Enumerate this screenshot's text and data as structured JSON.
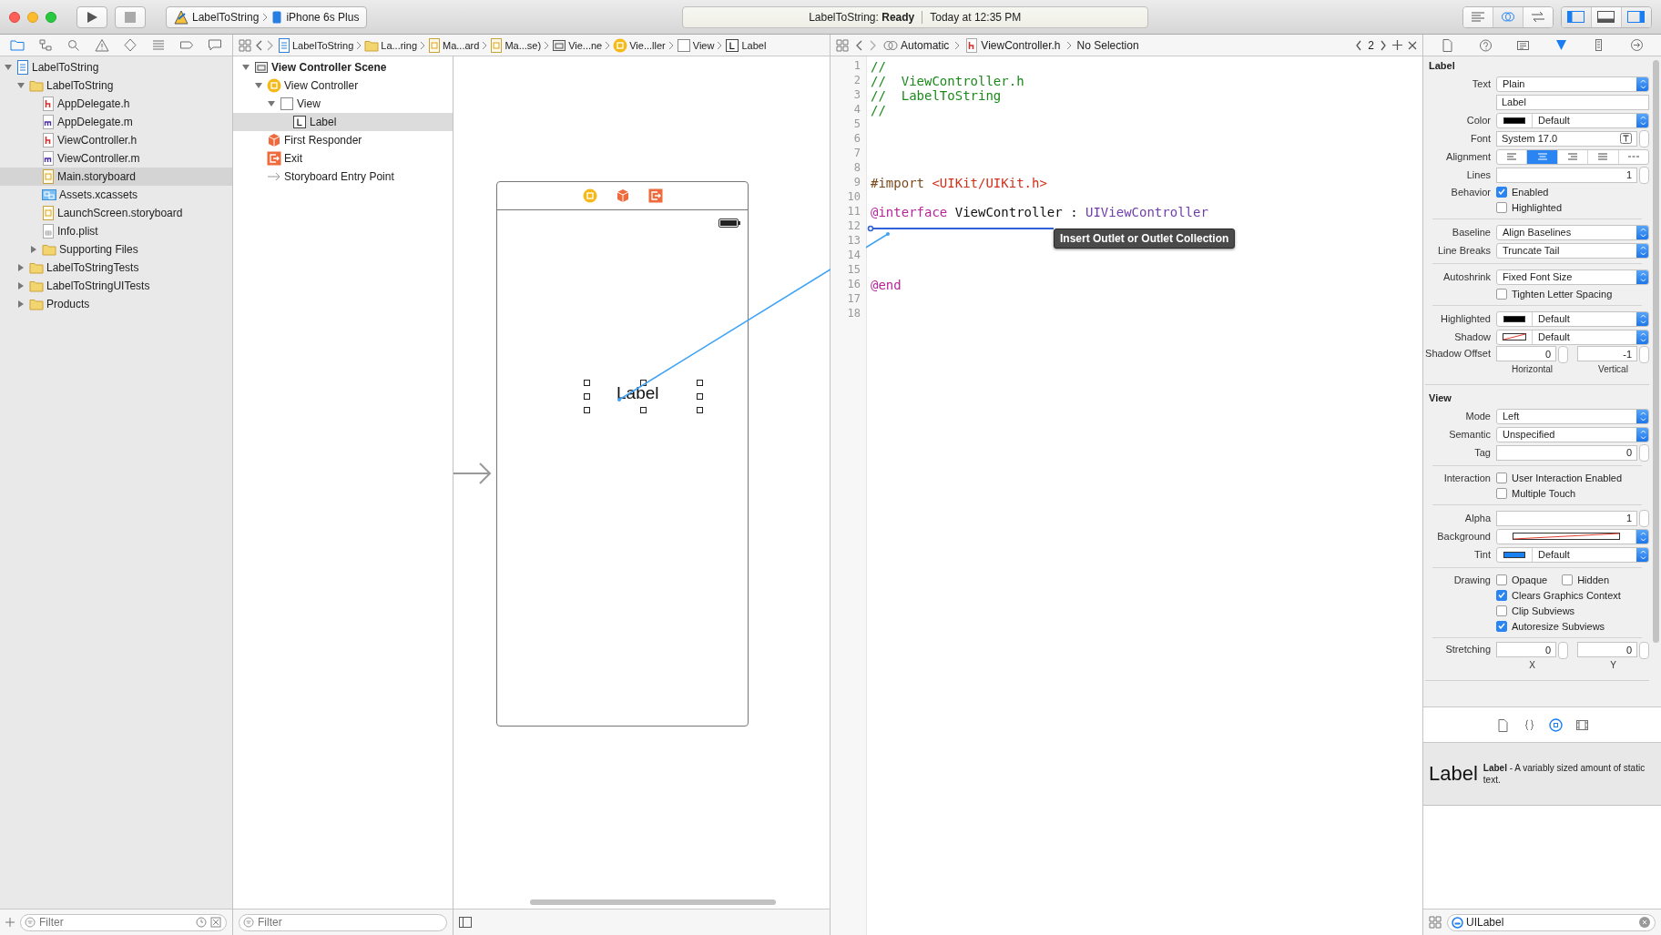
{
  "toolbar": {
    "scheme": "LabelToString",
    "device": "iPhone 6s Plus",
    "status": "LabelToString: **Ready**",
    "time": "Today at 12:35 PM",
    "editor_modes": [
      {
        "kind": "standard",
        "selected": false
      },
      {
        "kind": "assistant",
        "selected": true
      },
      {
        "kind": "version",
        "selected": false
      }
    ],
    "panels": [
      {
        "kind": "navigator",
        "selected": true
      },
      {
        "kind": "debug",
        "selected": false
      },
      {
        "kind": "utilities",
        "selected": true
      }
    ]
  },
  "navigator": {
    "tabs": [
      {
        "kind": "project",
        "selected": true
      },
      {
        "kind": "symbol",
        "selected": false
      },
      {
        "kind": "find",
        "selected": false
      },
      {
        "kind": "issue",
        "selected": false
      },
      {
        "kind": "test",
        "selected": false
      },
      {
        "kind": "debug",
        "selected": false
      },
      {
        "kind": "breakpoint",
        "selected": false
      },
      {
        "kind": "report",
        "selected": false
      }
    ],
    "tree": [
      {
        "name": "LabelToString",
        "kind": "project",
        "expanded": true,
        "selected": false,
        "children": [
          {
            "name": "LabelToString",
            "kind": "folder",
            "expanded": true,
            "selected": false,
            "children": [
              {
                "name": "AppDelegate.h",
                "kind": "header",
                "selected": false
              },
              {
                "name": "AppDelegate.m",
                "kind": "source",
                "selected": false
              },
              {
                "name": "ViewController.h",
                "kind": "header",
                "selected": false
              },
              {
                "name": "ViewController.m",
                "kind": "source",
                "selected": false
              },
              {
                "name": "Main.storyboard",
                "kind": "storyboard",
                "selected": true
              },
              {
                "name": "Assets.xcassets",
                "kind": "assets",
                "selected": false
              },
              {
                "name": "LaunchScreen.storyboard",
                "kind": "storyboard",
                "selected": false
              },
              {
                "name": "Info.plist",
                "kind": "plist",
                "selected": false
              },
              {
                "name": "Supporting Files",
                "kind": "folder",
                "expanded": false,
                "selected": false
              }
            ]
          },
          {
            "name": "LabelToStringTests",
            "kind": "folder",
            "expanded": false,
            "selected": false
          },
          {
            "name": "LabelToStringUITests",
            "kind": "folder",
            "expanded": false,
            "selected": false
          },
          {
            "name": "Products",
            "kind": "folder",
            "expanded": false,
            "selected": false
          }
        ]
      }
    ],
    "filter_placeholder": "Filter"
  },
  "interface_builder": {
    "jump_bar": [
      {
        "text": "LabelToString",
        "kind": "project"
      },
      {
        "text": "La...ring",
        "kind": "folder"
      },
      {
        "text": "Ma...ard",
        "kind": "storyboard"
      },
      {
        "text": "Ma...se)",
        "kind": "storyboard"
      },
      {
        "text": "Vie...ne",
        "kind": "scene"
      },
      {
        "text": "Vie...ller",
        "kind": "controller"
      },
      {
        "text": "View",
        "kind": "view"
      },
      {
        "text": "Label",
        "kind": "label"
      }
    ],
    "outline": [
      {
        "name": "View Controller Scene",
        "kind": "scene",
        "expanded": true,
        "selected": false,
        "children": [
          {
            "name": "View Controller",
            "kind": "controller",
            "expanded": true,
            "selected": false,
            "children": [
              {
                "name": "View",
                "kind": "view",
                "expanded": true,
                "selected": false,
                "children": [
                  {
                    "name": "Label",
                    "kind": "label",
                    "selected": true
                  }
                ]
              }
            ]
          },
          {
            "name": "First Responder",
            "kind": "responder",
            "selected": false
          },
          {
            "name": "Exit",
            "kind": "exit",
            "selected": false
          },
          {
            "name": "Storyboard Entry Point",
            "kind": "entry",
            "selected": false
          }
        ]
      }
    ],
    "filter_placeholder": "Filter",
    "canvas": {
      "label": {
        "text": "Label",
        "selected": true
      }
    }
  },
  "editor": {
    "jump_bar": [
      {
        "text": "Automatic",
        "kind": "assistant"
      },
      {
        "text": "ViewController.h",
        "kind": "header"
      },
      {
        "text": "No Selection",
        "kind": "none"
      }
    ],
    "counter": "2",
    "lines": [
      {
        "number": "1",
        "tokens": [
          {
            "kind": "comment",
            "text": "//"
          }
        ]
      },
      {
        "number": "2",
        "tokens": [
          {
            "kind": "comment",
            "text": "//  ViewController.h"
          }
        ]
      },
      {
        "number": "3",
        "tokens": [
          {
            "kind": "comment",
            "text": "//  LabelToString"
          }
        ]
      },
      {
        "number": "4",
        "tokens": [
          {
            "kind": "comment",
            "text": "//"
          }
        ]
      },
      {
        "number": "5"
      },
      {
        "number": "6"
      },
      {
        "number": "7"
      },
      {
        "number": "8"
      },
      {
        "number": "9",
        "tokens": [
          {
            "kind": "preprocessor",
            "text": "#import "
          },
          {
            "kind": "string",
            "text": "<UIKit/UIKit.h>"
          }
        ]
      },
      {
        "number": "10"
      },
      {
        "number": "11",
        "tokens": [
          {
            "kind": "keyword",
            "text": "@interface"
          },
          {
            "kind": "plain",
            "text": " ViewController : "
          },
          {
            "kind": "class",
            "text": "UIViewController"
          }
        ]
      },
      {
        "number": "12"
      },
      {
        "number": "13"
      },
      {
        "number": "14"
      },
      {
        "number": "15"
      },
      {
        "number": "16",
        "tokens": [
          {
            "kind": "keyword",
            "text": "@end"
          }
        ]
      },
      {
        "number": "17"
      },
      {
        "number": "18"
      }
    ],
    "tooltip": "Insert Outlet or Outlet Collection"
  },
  "inspector": {
    "tabs": [
      {
        "kind": "file",
        "selected": false
      },
      {
        "kind": "help",
        "selected": false
      },
      {
        "kind": "identity",
        "selected": false
      },
      {
        "kind": "attributes",
        "selected": true
      },
      {
        "kind": "size",
        "selected": false
      },
      {
        "kind": "connections",
        "selected": false
      }
    ],
    "sections": [
      {
        "title": "Label",
        "rows": [
          {
            "kind": "popup",
            "label": "Text",
            "value": "Plain"
          },
          {
            "kind": "text",
            "value": "Label"
          },
          {
            "kind": "color",
            "label": "Color",
            "color": "#000000",
            "value": "Default"
          },
          {
            "kind": "font",
            "label": "Font",
            "value": "System 17.0"
          },
          {
            "kind": "segments",
            "label": "Alignment",
            "segments": [
              {
                "kind": "left",
                "selected": false
              },
              {
                "kind": "center",
                "selected": true
              },
              {
                "kind": "right",
                "selected": false
              },
              {
                "kind": "justified",
                "selected": false
              },
              {
                "kind": "natural",
                "selected": false
              }
            ]
          },
          {
            "kind": "stepper",
            "label": "Lines",
            "value": "1"
          },
          {
            "kind": "checks",
            "label": "Behavior",
            "checks": [
              {
                "text": "Enabled",
                "checked": true
              }
            ]
          },
          {
            "kind": "checks",
            "checks": [
              {
                "text": "Highlighted",
                "checked": false
              }
            ]
          },
          {
            "kind": "divider"
          },
          {
            "kind": "popup",
            "label": "Baseline",
            "value": "Align Baselines"
          },
          {
            "kind": "popup",
            "label": "Line Breaks",
            "value": "Truncate Tail"
          },
          {
            "kind": "divider"
          },
          {
            "kind": "popup",
            "label": "Autoshrink",
            "value": "Fixed Font Size"
          },
          {
            "kind": "checks",
            "checks": [
              {
                "text": "Tighten Letter Spacing",
                "checked": false
              }
            ]
          },
          {
            "kind": "divider"
          },
          {
            "kind": "color",
            "label": "Highlighted",
            "color": "#000000",
            "value": "Default"
          },
          {
            "kind": "color",
            "label": "Shadow",
            "value": "Default"
          },
          {
            "kind": "pair",
            "label": "Shadow Offset",
            "fields": [
              {
                "value": "0",
                "caption": "Horizontal"
              },
              {
                "value": "-1",
                "caption": "Vertical"
              }
            ]
          }
        ]
      },
      {
        "title": "View",
        "rows": [
          {
            "kind": "popup",
            "label": "Mode",
            "value": "Left"
          },
          {
            "kind": "popup",
            "label": "Semantic",
            "value": "Unspecified"
          },
          {
            "kind": "stepper",
            "label": "Tag",
            "value": "0"
          },
          {
            "kind": "divider"
          },
          {
            "kind": "checks",
            "label": "Interaction",
            "checks": [
              {
                "text": "User Interaction Enabled",
                "checked": false
              }
            ]
          },
          {
            "kind": "checks",
            "checks": [
              {
                "text": "Multiple Touch",
                "checked": false
              }
            ]
          },
          {
            "kind": "divider"
          },
          {
            "kind": "stepper",
            "label": "Alpha",
            "value": "1"
          },
          {
            "kind": "color",
            "label": "Background"
          },
          {
            "kind": "color",
            "label": "Tint",
            "color": "#1a82f0",
            "value": "Default"
          },
          {
            "kind": "divider"
          },
          {
            "kind": "checks",
            "label": "Drawing",
            "checks": [
              {
                "text": "Opaque",
                "checked": false
              },
              {
                "text": "Hidden",
                "checked": false
              }
            ]
          },
          {
            "kind": "checks",
            "checks": [
              {
                "text": "Clears Graphics Context",
                "checked": true
              }
            ]
          },
          {
            "kind": "checks",
            "checks": [
              {
                "text": "Clip Subviews",
                "checked": false
              }
            ]
          },
          {
            "kind": "checks",
            "checks": [
              {
                "text": "Autoresize Subviews",
                "checked": true
              }
            ]
          },
          {
            "kind": "divider"
          },
          {
            "kind": "pair",
            "label": "Stretching",
            "fields": [
              {
                "value": "0",
                "caption": "X"
              },
              {
                "value": "0",
                "caption": "Y"
              }
            ]
          }
        ]
      }
    ]
  },
  "library": {
    "tabs": [
      {
        "kind": "file",
        "selected": false
      },
      {
        "kind": "snippet",
        "selected": false
      },
      {
        "kind": "object",
        "selected": true
      },
      {
        "kind": "media",
        "selected": false
      }
    ],
    "item": {
      "preview": "Label",
      "description": "**Label** - A variably sized amount of static text."
    },
    "filter": {
      "value": "UILabel"
    }
  }
}
